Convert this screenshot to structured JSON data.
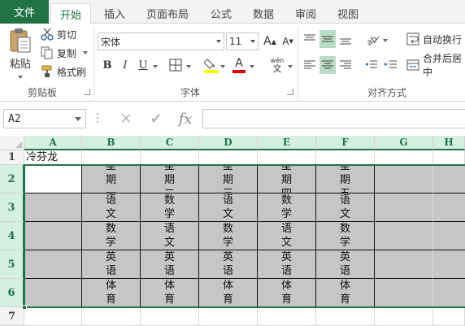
{
  "tabs": {
    "file": "文件",
    "items": [
      {
        "id": "home",
        "label": "开始",
        "active": true
      },
      {
        "id": "insert",
        "label": "插入"
      },
      {
        "id": "layout",
        "label": "页面布局"
      },
      {
        "id": "formulas",
        "label": "公式"
      },
      {
        "id": "data",
        "label": "数据"
      },
      {
        "id": "review",
        "label": "审阅"
      },
      {
        "id": "view",
        "label": "视图"
      }
    ]
  },
  "ribbon": {
    "clipboard": {
      "paste": "粘贴",
      "cut": "剪切",
      "copy": "复制",
      "format_painter": "格式刷",
      "group_label": "剪贴板"
    },
    "font": {
      "font_name": "宋体",
      "font_size": "11",
      "grow_label": "A",
      "shrink_label": "A",
      "bold": "B",
      "italic": "I",
      "underline": "U",
      "font_color_glyph": "A",
      "wen_top": "wén",
      "wen_bottom": "文",
      "group_label": "字体"
    },
    "alignment": {
      "wrap_text": "自动换行",
      "merge_center": "合并后居中",
      "group_label": "对齐方式"
    }
  },
  "formula_bar": {
    "name_box": "A2",
    "cancel_glyph": "✕",
    "enter_glyph": "✔",
    "fx": "fx",
    "content": ""
  },
  "columns": [
    "A",
    "B",
    "C",
    "D",
    "E",
    "F",
    "G",
    "H"
  ],
  "rows": [
    "1",
    "2",
    "3",
    "4",
    "5",
    "6",
    "7"
  ],
  "sheet": {
    "a1": "冷芬龙",
    "row2": [
      "星期一",
      "星期二",
      "星期三",
      "星期四",
      "星期五"
    ],
    "row3": [
      "语文",
      "数学",
      "语文",
      "数学",
      "语文"
    ],
    "row4": [
      "数学",
      "语文",
      "数学",
      "语文",
      "数学"
    ],
    "row5": [
      "英语",
      "英语",
      "英语",
      "英语",
      "英语"
    ],
    "row6": [
      "体育",
      "体育",
      "体育",
      "体育",
      "体育"
    ]
  },
  "colors": {
    "accent": "#217346",
    "selection_fill": "#c6c6c6"
  }
}
